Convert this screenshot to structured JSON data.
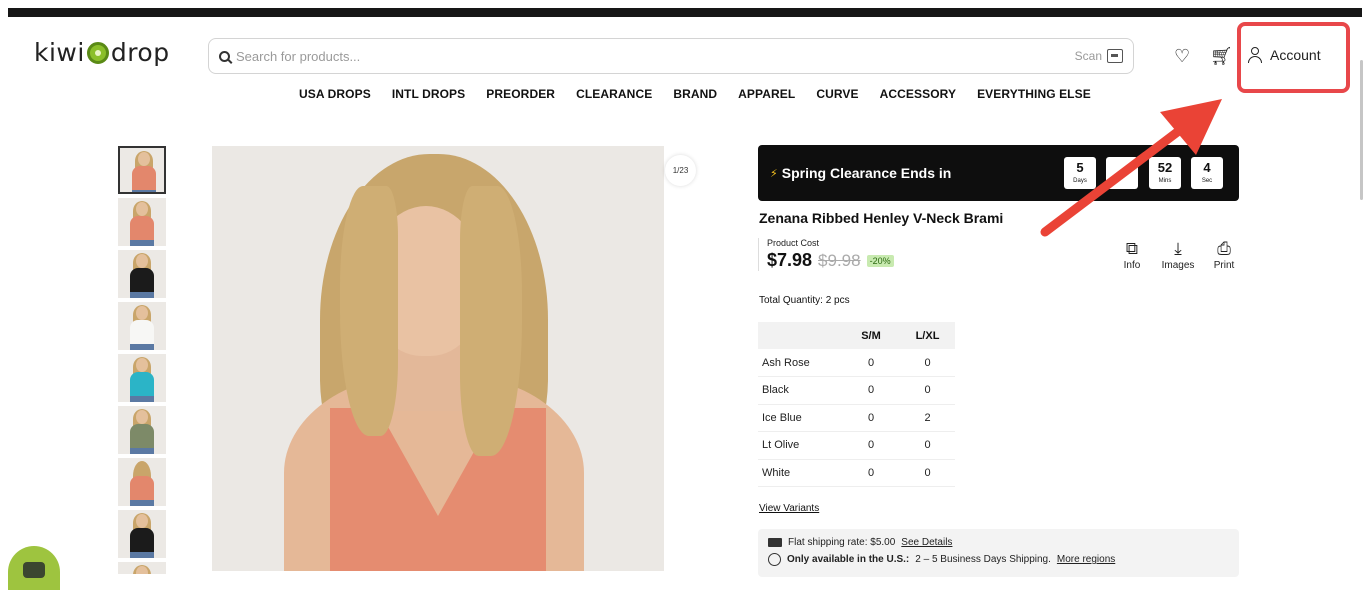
{
  "brand": {
    "logo_text_left": "kiwi",
    "logo_text_right": "drop"
  },
  "search": {
    "placeholder": "Search for products...",
    "scan_label": "Scan"
  },
  "header": {
    "account_label": "Account"
  },
  "nav": {
    "items": [
      "USA DROPS",
      "INTL DROPS",
      "PREORDER",
      "CLEARANCE",
      "BRAND",
      "APPAREL",
      "CURVE",
      "ACCESSORY",
      "EVERYTHING ELSE"
    ]
  },
  "gallery": {
    "counter": "1/23",
    "thumbnail_count": 9
  },
  "promo": {
    "title": "Spring Clearance Ends in",
    "countdown": [
      {
        "value": "5",
        "unit": "Days"
      },
      {
        "value": "",
        "unit": "s"
      },
      {
        "value": "52",
        "unit": "Mins"
      },
      {
        "value": "4",
        "unit": "Sec"
      }
    ]
  },
  "product": {
    "title": "Zenana Ribbed Henley V-Neck Brami",
    "cost_label": "Product Cost",
    "price": "$7.98",
    "old_price": "$9.98",
    "discount": "-20%",
    "total_quantity": "Total Quantity: 2 pcs"
  },
  "actions": [
    {
      "icon": "copy-icon",
      "label": "Info"
    },
    {
      "icon": "download-icon",
      "label": "Images"
    },
    {
      "icon": "print-icon",
      "label": "Print"
    }
  ],
  "variants": {
    "columns": [
      "",
      "S/M",
      "L/XL"
    ],
    "rows": [
      [
        "Ash Rose",
        "0",
        "0"
      ],
      [
        "Black",
        "0",
        "0"
      ],
      [
        "Ice Blue",
        "0",
        "2"
      ],
      [
        "Lt Olive",
        "0",
        "0"
      ],
      [
        "White",
        "0",
        "0"
      ]
    ],
    "link": "View Variants"
  },
  "shipping": {
    "line1_text": "Flat shipping rate: $5.00",
    "line1_link": "See Details",
    "line2_bold": "Only available in the U.S.:",
    "line2_text": "2 – 5 Business Days Shipping.",
    "line2_link": "More regions"
  },
  "colors": {
    "highlight": "#e8474a",
    "arrow": "#ea4336",
    "promo_bg": "#0e0e0e",
    "discount_bg": "#c8eab0"
  }
}
